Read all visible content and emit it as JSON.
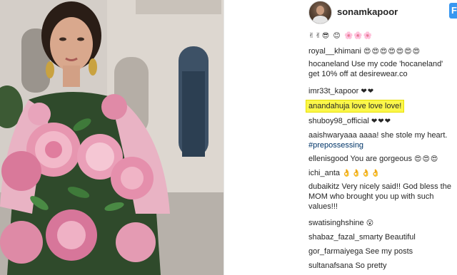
{
  "post": {
    "account": "sonamkapoor",
    "follow_label": "F"
  },
  "comments": [
    {
      "user": "",
      "text": "",
      "emoji": "✌✌😎 😊  🌸🌸🌸",
      "partial": true
    },
    {
      "user": "royal__khimani",
      "text": "",
      "emoji": "😍😍😍😍😍😍😍"
    },
    {
      "user": "hocaneland",
      "text": "Use my code 'hocaneland' get 10% off at desirewear.co"
    },
    {
      "user": "imr33t_kapoor",
      "text": "",
      "emoji": "❤❤"
    },
    {
      "user": "anandahuja",
      "text": "love love love!",
      "highlight": true
    },
    {
      "user": "shuboy98_official",
      "text": "",
      "emoji": "❤❤❤"
    },
    {
      "user": "aaishwaryaaa",
      "text": "aaaa! she stole my heart.",
      "hashtag": "#prepossessing"
    },
    {
      "user": "ellenisgood",
      "text": "You are gorgeous",
      "emoji": "😍😍😍"
    },
    {
      "user": "ichi_anta",
      "text": "",
      "emoji": "👌👌👌👌"
    },
    {
      "user": "dubaikitz",
      "text": "Very nicely said!! God bless the MOM who brought you up with such values!!!"
    },
    {
      "user": "swatisinghshine",
      "text": "",
      "emoji": "😮"
    },
    {
      "user": "shabaz_fazal_smarty",
      "text": "Beautiful"
    },
    {
      "user": "gor_farmaiyega",
      "text": "See my posts"
    },
    {
      "user": "sultanafsana",
      "text": "So pretty"
    }
  ],
  "colors": {
    "follow_blue": "#3897f0",
    "highlight_yellow": "#fbf74a",
    "hashtag_blue": "#003569",
    "text": "#262626"
  },
  "icons": {
    "avatar": "profile-avatar"
  }
}
